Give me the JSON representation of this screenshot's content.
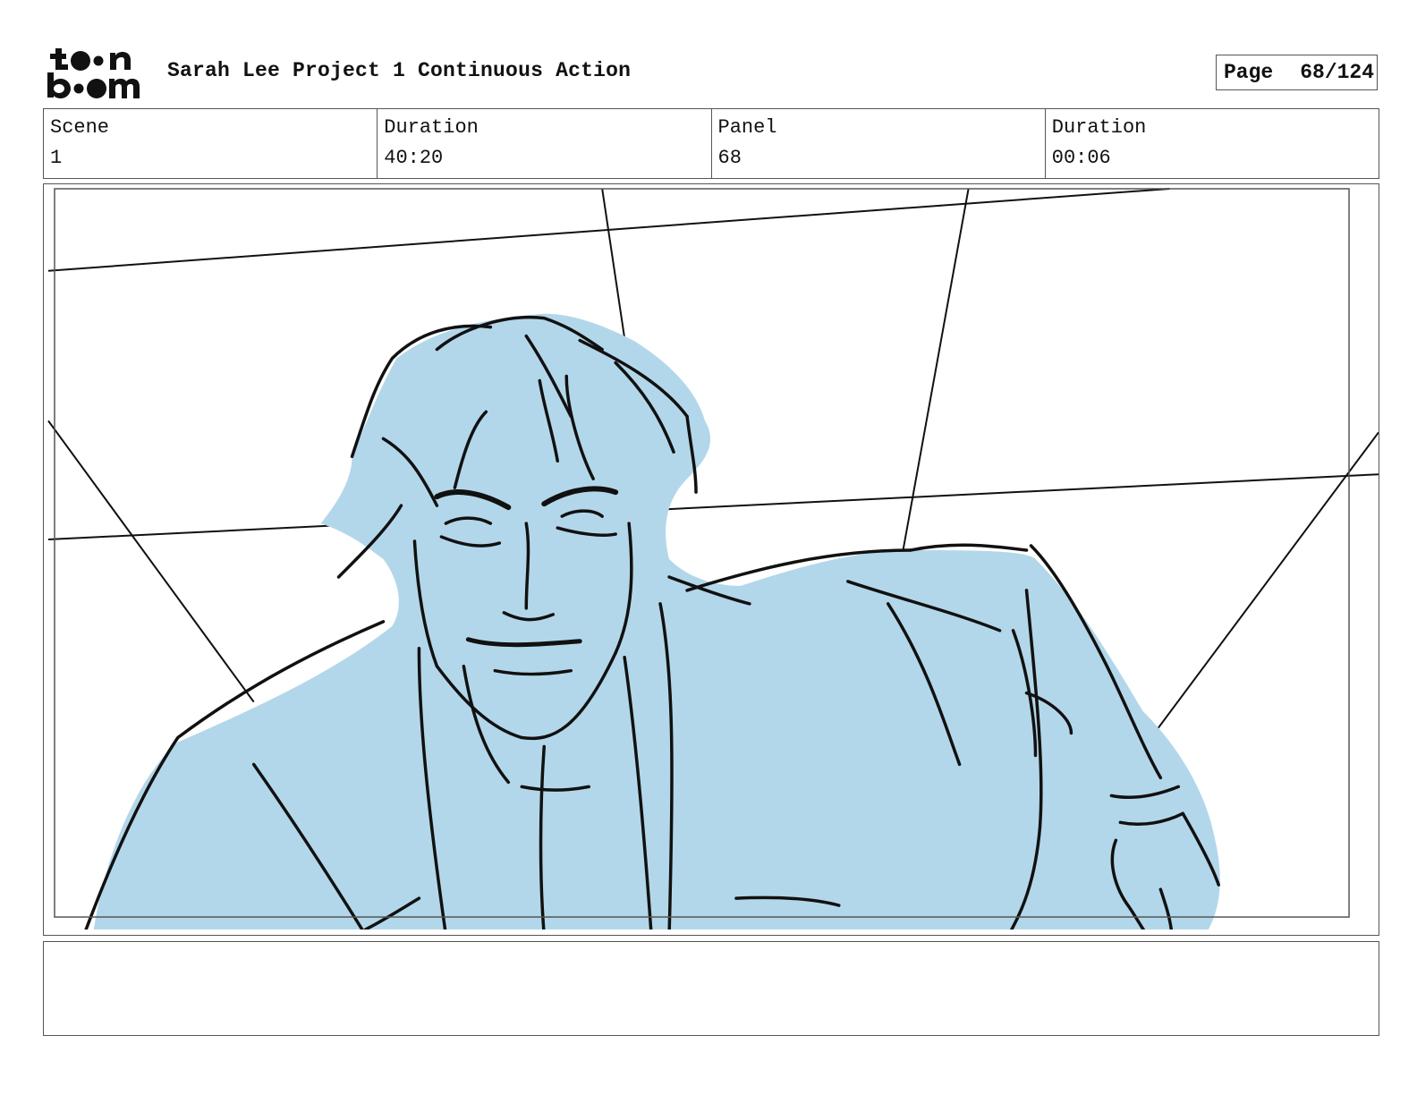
{
  "header": {
    "logo_text": "toon boom",
    "project_title": "Sarah Lee Project 1 Continuous Action",
    "page_label": "Page",
    "page_number": "68/124"
  },
  "info": {
    "scene_label": "Scene",
    "scene_value": "1",
    "scene_duration_label": "Duration",
    "scene_duration_value": "40:20",
    "panel_label": "Panel",
    "panel_value": "68",
    "panel_duration_label": "Duration",
    "panel_duration_value": "00:06"
  },
  "panel": {
    "fill_color": "#b3d7ea",
    "line_color": "#111111"
  },
  "notes": {
    "text": ""
  }
}
